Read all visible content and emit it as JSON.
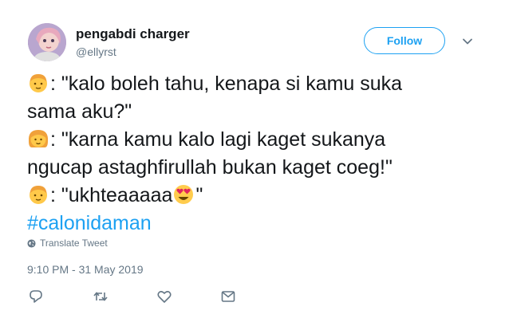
{
  "user": {
    "display_name": "pengabdi charger",
    "handle": "@ellyrst"
  },
  "follow_button": {
    "label": "Follow"
  },
  "tweet": {
    "lines": [
      {
        "emoji": "boy",
        "text": ": \"kalo boleh tahu, kenapa si kamu suka"
      },
      {
        "emoji": "",
        "text": "sama aku?\""
      },
      {
        "emoji": "girl",
        "text": ": \"karna kamu kalo lagi kaget sukanya"
      },
      {
        "emoji": "",
        "text": "ngucap astaghfirullah bukan kaget coeg!\""
      }
    ],
    "last_line_prefix": ": \"ukhteaaaaa",
    "last_line_suffix": "\"",
    "hashtag": "#calonidaman"
  },
  "translate": {
    "label": "Translate Tweet"
  },
  "timestamp": "9:10 PM - 31 May 2019",
  "icons": {
    "reply": "reply-icon",
    "retweet": "retweet-icon",
    "like": "heart-icon",
    "dm": "envelope-icon",
    "more": "chevron-down-icon",
    "globe": "globe-icon"
  },
  "colors": {
    "accent": "#1da1f2",
    "text": "#14171a",
    "muted": "#657786"
  }
}
